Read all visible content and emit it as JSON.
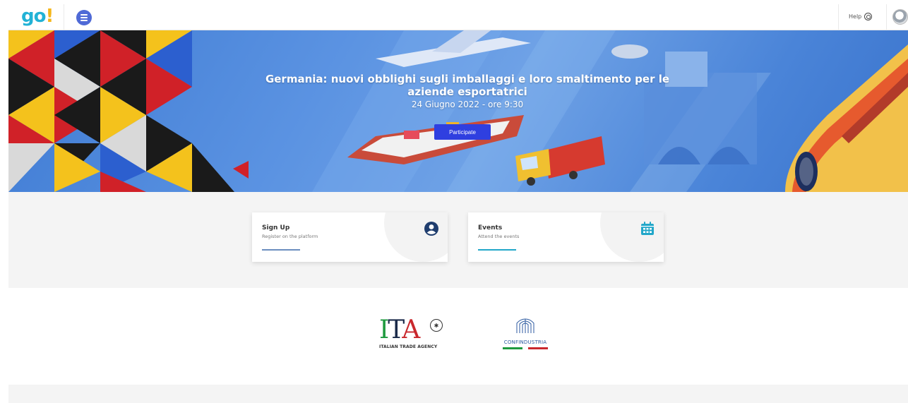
{
  "header": {
    "logo_main": "go",
    "logo_bang": "!",
    "menu_icon": "hamburger-menu-icon",
    "help_label": "Help",
    "help_icon": "help-circle-icon",
    "avatar_icon": "user-avatar-icon"
  },
  "hero": {
    "title": "Germania: nuovi obblighi sugli imballaggi e loro smaltimento per le aziende esportatrici",
    "date": "24 Giugno 2022 - ore 9:30",
    "cta_label": "Participate"
  },
  "cards": [
    {
      "title": "Sign Up",
      "subtitle": "Register on the platform",
      "icon": "user-circle-icon",
      "accent": "#6b8ebf"
    },
    {
      "title": "Events",
      "subtitle": "Attend the events",
      "icon": "calendar-icon",
      "accent": "#22a7c9"
    }
  ],
  "logos": {
    "ita_letters": "ITA",
    "ita_sub": "ITALIAN TRADE AGENCY",
    "confindustria": "CONFINDUSTRIA"
  },
  "colors": {
    "brand_blue": "#22b2d6",
    "brand_yellow": "#f5b619",
    "cta_blue": "#2f3fe0",
    "menu_blue": "#4f6ad6"
  }
}
